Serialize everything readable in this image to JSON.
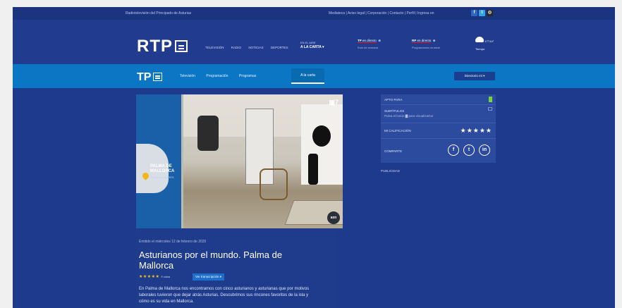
{
  "topbar": {
    "left_text": "Radiotelevisión del Principado de Asturias",
    "right_text": "Mediateca | Aviso legal | Corporación | Contacto | Perfil | Ingresa en",
    "social": [
      "f",
      "t",
      "◎"
    ]
  },
  "header": {
    "logo": "RTP",
    "nav": [
      "TELEVISIÓN",
      "RADIO",
      "NOTICIAS",
      "DEPORTES"
    ],
    "alacarta_small": "EN EL AIRE",
    "alacarta": "A LA CARTA ▾",
    "live_tv": {
      "brand": "TP",
      "label": "en directo",
      "sub": "Esto de semana"
    },
    "live_radio": {
      "brand": "RP",
      "label": "en directo",
      "sub": "Programación musical"
    },
    "weather": {
      "temp": "17°/14°",
      "label": "Tiempo"
    }
  },
  "subnav": {
    "logo": "TP",
    "items": [
      "Televisión",
      "Programación",
      "Programas"
    ],
    "active": "A la carta",
    "dropdown": "Directorio mi ▾"
  },
  "hero": {
    "map_label": "PALMA DE\nMALLORCA",
    "map_sub": "ISLAS BALEARES",
    "channel_badge": "7",
    "corner_badge": "axn"
  },
  "episode": {
    "emitido": "Emitido el miércoles 12 de febrero de 2020",
    "title": "Asturianos por el mundo. Palma de Mallorca",
    "stars": "★★★★★",
    "votes": "9 votos",
    "transcription_btn": "Ver transcripción ▾",
    "description": "En Palma de Mallorca nos encontramos con cinco asturianos y asturianas que por motivos laborales tuvieron que dejar atrás Asturias. Descubrimos sus rincones favoritos de la isla y cómo es su vida en Mallorca."
  },
  "sidebar": {
    "apto_label": "APTO PARA",
    "subtitulos_label": "SUBTÍTULOS",
    "subtitulos_sub": "Pulsa el botón ▇ para visualizarlos",
    "calificacion_label": "MI CALIFICACIÓN",
    "calificacion_stars": "★★★★★",
    "comparte_label": "COMPARTE",
    "share_icons": [
      "f",
      "t",
      "in"
    ],
    "publicidad": "PUBLICIDAD"
  }
}
